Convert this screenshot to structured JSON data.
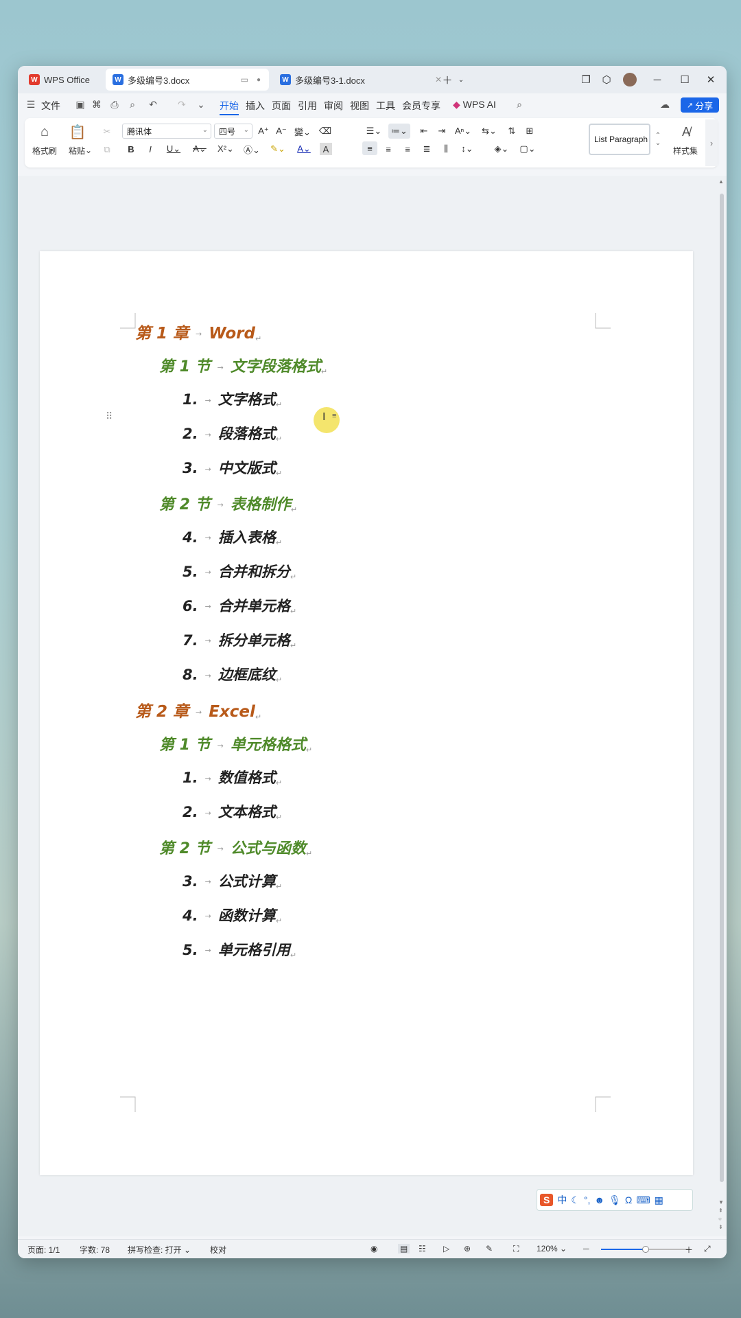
{
  "tabs": [
    {
      "label": "WPS Office",
      "active": false
    },
    {
      "label": "多级编号3.docx",
      "active": true
    },
    {
      "label": "多级编号3-1.docx",
      "active": false
    }
  ],
  "menu": {
    "file": "文件",
    "items": [
      "开始",
      "插入",
      "页面",
      "引用",
      "审阅",
      "视图",
      "工具",
      "会员专享"
    ],
    "active": "开始",
    "wps_ai": "WPS AI",
    "share": "分享"
  },
  "ribbon": {
    "format_painter": "格式刷",
    "paste": "粘贴",
    "font_name": "腾讯体",
    "font_size": "四号",
    "style_name": "List Paragraph",
    "styles_label": "样式集"
  },
  "document": {
    "lines": [
      {
        "level": 1,
        "prefix": "第 1 章",
        "text": "Word"
      },
      {
        "level": 2,
        "prefix": "第 1 节",
        "text": "文字段落格式"
      },
      {
        "level": 3,
        "prefix": "1.",
        "text": "文字格式"
      },
      {
        "level": 3,
        "prefix": "2.",
        "text": "段落格式"
      },
      {
        "level": 3,
        "prefix": "3.",
        "text": "中文版式"
      },
      {
        "level": 2,
        "prefix": "第 2 节",
        "text": "表格制作"
      },
      {
        "level": 3,
        "prefix": "4.",
        "text": "插入表格"
      },
      {
        "level": 3,
        "prefix": "5.",
        "text": "合并和拆分"
      },
      {
        "level": 3,
        "prefix": "6.",
        "text": "合并单元格"
      },
      {
        "level": 3,
        "prefix": "7.",
        "text": "拆分单元格"
      },
      {
        "level": 3,
        "prefix": "8.",
        "text": "边框底纹"
      },
      {
        "level": 1,
        "prefix": "第 2 章",
        "text": "Excel"
      },
      {
        "level": 2,
        "prefix": "第 1 节",
        "text": "单元格格式"
      },
      {
        "level": 3,
        "prefix": "1.",
        "text": "数值格式"
      },
      {
        "level": 3,
        "prefix": "2.",
        "text": "文本格式"
      },
      {
        "level": 2,
        "prefix": "第 2 节",
        "text": "公式与函数"
      },
      {
        "level": 3,
        "prefix": "3.",
        "text": "公式计算"
      },
      {
        "level": 3,
        "prefix": "4.",
        "text": "函数计算"
      },
      {
        "level": 3,
        "prefix": "5.",
        "text": "单元格引用"
      }
    ],
    "colors": {
      "chapter": "#b85a1a",
      "section": "#4f8a2a",
      "item": "#222222"
    }
  },
  "ime": {
    "lang": "中"
  },
  "status": {
    "page": "页面: 1/1",
    "words": "字数: 78",
    "spellcheck": "拼写检查: 打开",
    "proof": "校对",
    "zoom": "120%"
  }
}
